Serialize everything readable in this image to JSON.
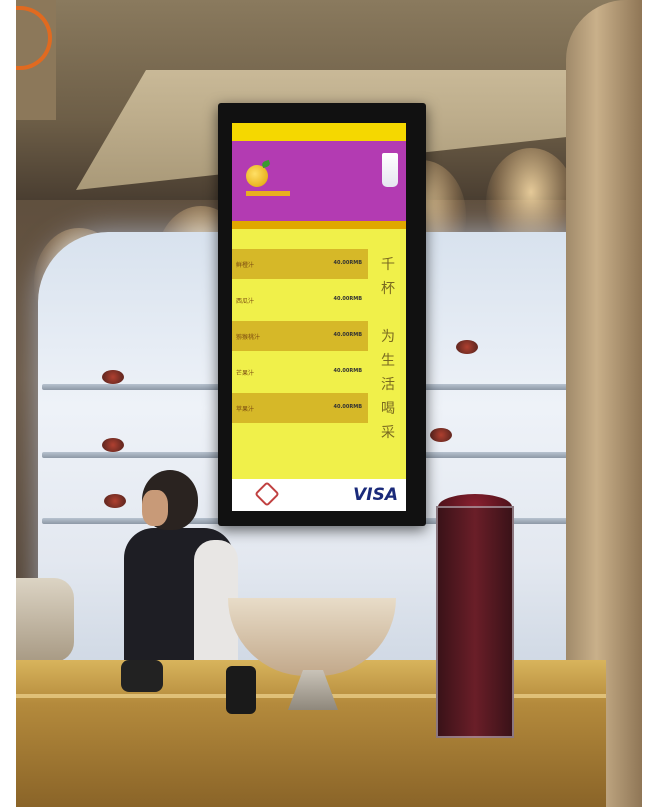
{
  "scene": {
    "description_free": true
  },
  "screen": {
    "brand_mark": "VISA",
    "slogan_chars": [
      "千",
      "杯",
      "",
      "为",
      "生",
      "活",
      "喝",
      "采"
    ],
    "menu_items": [
      {
        "name": "鲜橙汁",
        "price": "40.00RMB",
        "shaded": true
      },
      {
        "name": "西瓜汁",
        "price": "40.00RMB",
        "shaded": false
      },
      {
        "name": "猕猴桃汁",
        "price": "40.00RMB",
        "shaded": true
      },
      {
        "name": "芒果汁",
        "price": "40.00RMB",
        "shaded": false
      },
      {
        "name": "苹果汁",
        "price": "40.00RMB",
        "shaded": true
      }
    ]
  },
  "colors": {
    "screen_bg": "#f0f04a",
    "header": "#b33bb2",
    "accent": "#e0a800",
    "visa": "#1a2a7a"
  }
}
